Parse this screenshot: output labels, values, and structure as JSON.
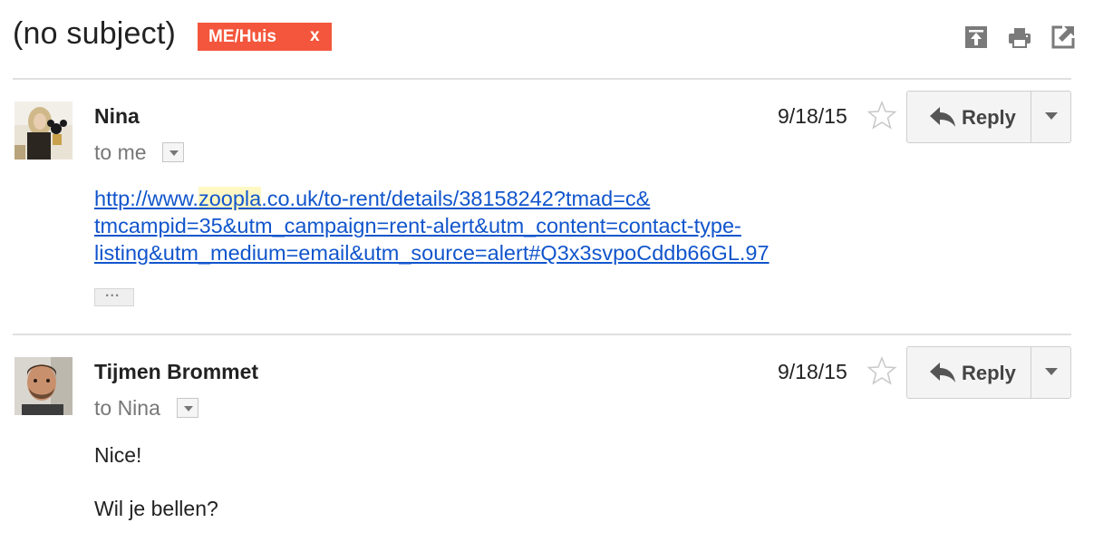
{
  "thread": {
    "subject": "(no subject)",
    "label": "ME/Huis",
    "label_remove": "x"
  },
  "toolbar": {
    "icons": [
      "archive-up-icon",
      "print-icon",
      "new-window-icon"
    ]
  },
  "messages": [
    {
      "sender": "Nina",
      "recipient": "to me",
      "date": "9/18/15",
      "reply_label": "Reply",
      "link_lines": [
        "http://www.zoopla.co.uk/to-rent/details/38158242?tmad=c&",
        "tmcampid=35&utm_campaign=rent-alert&utm_content=contact-type-",
        "listing&utm_medium=email&utm_source=alert#Q3x3svpoCddb66GL.97"
      ],
      "link_line1_pre": "http://www.",
      "link_line1_hl": "zoopla",
      "link_line1_post": ".co.uk/to-rent/details/38158242?tmad=c&",
      "ellipsis": "..."
    },
    {
      "sender": "Tijmen Brommet",
      "recipient": "to Nina",
      "date": "9/18/15",
      "reply_label": "Reply",
      "body_lines": [
        "Nice!",
        "Wil je bellen?"
      ]
    }
  ]
}
